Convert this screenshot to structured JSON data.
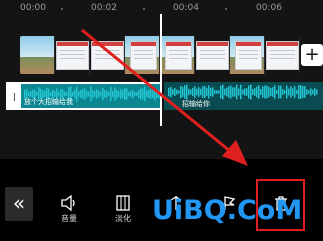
{
  "timeline": {
    "ruler_marks": [
      "00:00",
      "00:02",
      "00:04",
      "00:06"
    ]
  },
  "video_track": {
    "frame_count": 8,
    "add_icon": "plus-icon"
  },
  "audio_track": {
    "selected_clip_label": "放个大招输给我",
    "second_clip_label": "招输给你"
  },
  "toolbar": {
    "collapse_icon": "double-chevron-left-icon",
    "tools": [
      {
        "icon": "volume-icon",
        "label": "音量"
      },
      {
        "icon": "fade-icon",
        "label": "淡化"
      },
      {
        "icon": "split-icon",
        "label": ""
      },
      {
        "icon": "beat-icon",
        "label": ""
      },
      {
        "icon": "delete-icon",
        "label": ""
      }
    ]
  },
  "watermark": {
    "text": "UiBQ.CoM"
  },
  "colors": {
    "waveform": "#22c4d0",
    "annotation": "#e02020",
    "watermark": "#2196f3",
    "background": "#141414"
  }
}
